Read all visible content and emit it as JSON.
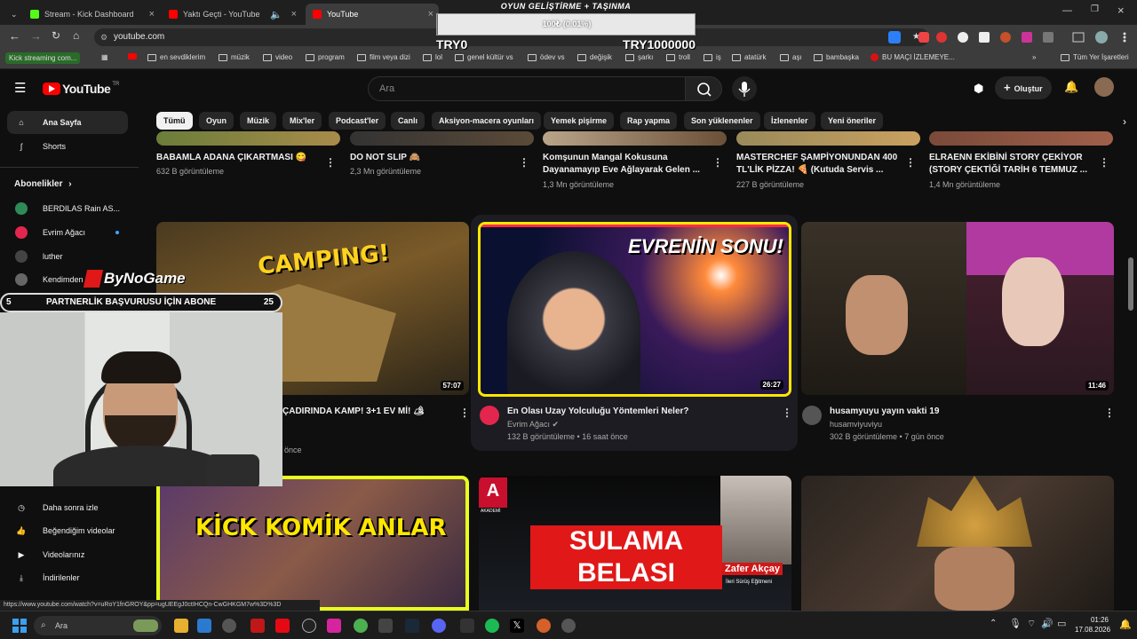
{
  "browser": {
    "tabs": [
      {
        "title": "Stream - Kick Dashboard",
        "color": "#53fc18"
      },
      {
        "title": "Yaktı Geçti - YouTube",
        "color": "#ff0000"
      },
      {
        "title": "YouTube",
        "color": "#ff0000"
      }
    ],
    "url": "youtube.com",
    "bookmarks": [
      "Kick streaming com...",
      "en sevdiklerim",
      "müzik",
      "video",
      "program",
      "film veya dizi",
      "lol",
      "genel kültür vs",
      "ödev vs",
      "değişik",
      "şarkı",
      "troll",
      "iş",
      "atatürk",
      "aşı",
      "bambaşka",
      "BU MAÇI İZLEMEYE...",
      "Tüm Yer İşaretleri"
    ],
    "status_url": "https://www.youtube.com/watch?v=uRoY1fnGROY&pp=ugUEEgJ0ctIHCQn-CwGHKGM7w%3D%3D"
  },
  "overlay": {
    "goal_title": "OYUN GELİŞTİRME + TAŞINMA",
    "goal_progress_text": "100₺ (0.01%)",
    "goal_progress": 0.0001,
    "goal_min": "TRY0",
    "goal_max": "TRY1000000",
    "brand": "ByNoGame",
    "partner_left": "5",
    "partner_text": "PARTNERLİK BAŞVURUSU İÇİN ABONE",
    "partner_right": "25"
  },
  "youtube": {
    "logo": "YouTube",
    "logo_sup": "TR",
    "search_placeholder": "Ara",
    "create_label": "Oluştur",
    "chips": [
      "Tümü",
      "Oyun",
      "Müzik",
      "Mix'ler",
      "Podcast'ler",
      "Canlı",
      "Aksiyon-macera oyunları",
      "Yemek pişirme",
      "Rap yapma",
      "Son yüklenenler",
      "İzlenenler",
      "Yeni öneriler"
    ],
    "sidebar": {
      "home": "Ana Sayfa",
      "shorts": "Shorts",
      "subs_heading": "Abonelikler",
      "subs": [
        {
          "name": "BERDILAS Rain AS...",
          "color": "#2e8b57"
        },
        {
          "name": "Evrim Ağacı",
          "color": "#e2264d"
        },
        {
          "name": "luther",
          "color": "#444"
        },
        {
          "name": "Kendimden",
          "color": "#666"
        }
      ],
      "you_items": [
        "Daha sonra izle",
        "Beğendiğim videolar",
        "Videolarınız",
        "İndirilenler"
      ]
    },
    "row1": [
      {
        "title": "BABAMLA ADANA ÇIKARTMASI 😋",
        "title2": "",
        "meta": "632 B görüntüleme"
      },
      {
        "title": "DO NOT SLIP 🙈",
        "title2": "",
        "meta": "2,3 Mn görüntüleme"
      },
      {
        "title": "Komşunun Mangal Kokusuna",
        "title2": "Dayanamayıp Eve Ağlayarak Gelen ...",
        "meta": "1,3 Mn görüntüleme"
      },
      {
        "title": "MASTERCHEF ŞAMPİYONUNDAN 400",
        "title2": "TL'LİK PİZZA! 🍕 (Kutuda Servis ...",
        "meta": "227 B görüntüleme"
      },
      {
        "title": "ELRAENN EKİBİNİ STORY ÇEKİYOR",
        "title2": "(STORY ÇEKTİĞİ TARİH 6 TEMMUZ ...",
        "meta": "1,4 Mn görüntüleme"
      }
    ],
    "row2": [
      {
        "thumb_text": "CAMPING!",
        "duration": "57:07",
        "title": "ÇADIRINDA KAMP! 3+1 EV Mİ! 🏕",
        "channel": "",
        "meta": "önce"
      },
      {
        "thumb_text": "EVRENİN SONU!",
        "duration": "26:27",
        "title": "En Olası Uzay Yolculuğu Yöntemleri Neler?",
        "channel": "Evrim Ağacı ✔",
        "meta": "132 B görüntüleme • 16 saat önce"
      },
      {
        "thumb_text": "",
        "duration": "11:46",
        "title": "husamyuyu yayın vakti 19",
        "channel": "husamviyuviyu",
        "meta": "302 B görüntüleme • 7 gün önce"
      }
    ],
    "row3": [
      {
        "thumb_text": "KİCK KOMİK ANLAR"
      },
      {
        "thumb_text": "SULAMA BELASI",
        "sub": "Zafer Akçay",
        "sub2": "İleri Sürüş Eğitmeni",
        "brand": "AKADEMİ"
      },
      {
        "thumb_text": ""
      }
    ]
  },
  "taskbar": {
    "search": "Ara",
    "time": "01:26",
    "date": "17.08.2026"
  }
}
